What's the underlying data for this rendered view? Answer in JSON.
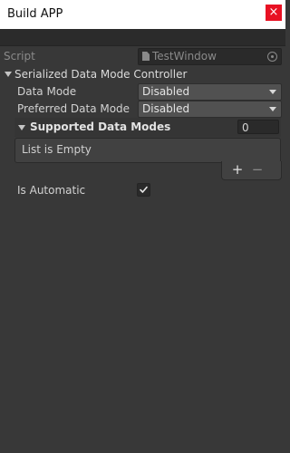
{
  "window": {
    "title": "Build APP",
    "close_glyph": "×"
  },
  "inspector": {
    "script": {
      "label": "Script",
      "value": "TestWindow"
    },
    "section": {
      "title": "Serialized Data Mode Controller"
    },
    "data_mode": {
      "label": "Data Mode",
      "value": "Disabled"
    },
    "preferred_data_mode": {
      "label": "Preferred Data Mode",
      "value": "Disabled"
    },
    "supported_data_modes": {
      "label": "Supported Data Modes",
      "size": "0",
      "empty_text": "List is Empty",
      "add_glyph": "+",
      "remove_glyph": "−"
    },
    "is_automatic": {
      "label": "Is Automatic",
      "checked": true
    }
  },
  "colors": {
    "background": "#383838",
    "close_button": "#e81123",
    "text": "#d2d2d2"
  },
  "icons": {
    "script_icon": "file-icon",
    "object_picker": "target-icon",
    "checkmark": "check-icon"
  }
}
